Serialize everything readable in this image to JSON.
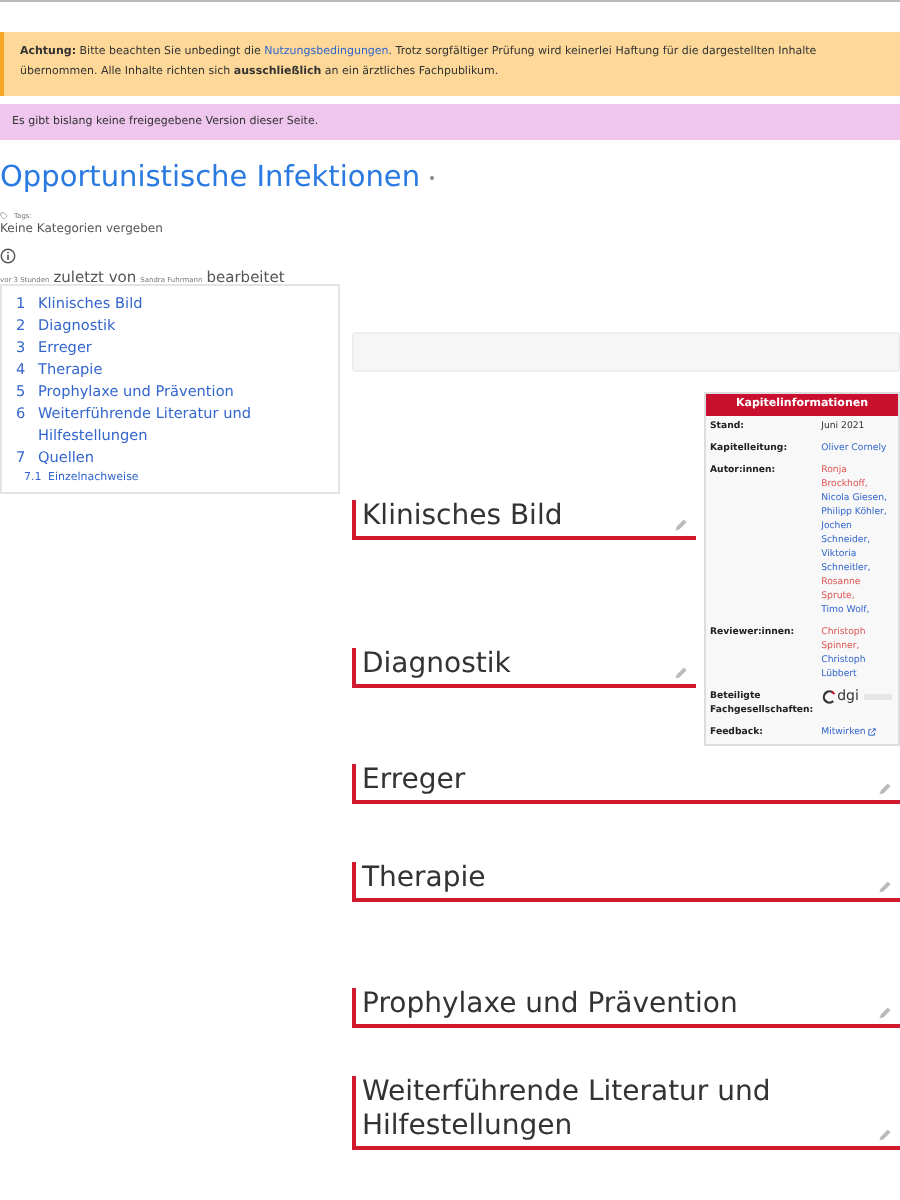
{
  "notice": {
    "label": "Achtung:",
    "before": "Bitte beachten Sie unbedingt die",
    "link": "Nutzungsbedingungen",
    "after": ". Trotz sorgfältiger Prüfung wird keinerlei Haftung für die dargestellten Inhalte übernommen. Alle Inhalte richten sich **ausschließlich** an ein ärztliches Fachpublikum."
  },
  "revision_notice": "Es gibt bislang keine freigegebene Version dieser Seite.",
  "page_title": "Opportunistische Infektionen",
  "tags_label": "Tags:",
  "categories": "Keine Kategorien vergeben",
  "edit_info": [
    {
      "text": "vor 3 Stunden",
      "kind": "small"
    },
    {
      "text": "zuletzt von",
      "kind": "large"
    },
    {
      "text": "Sandra Fuhrmann",
      "kind": "small"
    },
    {
      "text": "bearbeitet",
      "kind": "large"
    }
  ],
  "toc": [
    {
      "number": "1",
      "label": "Klinisches Bild"
    },
    {
      "number": "2",
      "label": "Diagnostik"
    },
    {
      "number": "3",
      "label": "Erreger"
    },
    {
      "number": "4",
      "label": "Therapie"
    },
    {
      "number": "5",
      "label": "Prophylaxe und Prävention"
    },
    {
      "number": "6",
      "label": "Weiterführende Literatur und Hilfestellungen"
    },
    {
      "number": "7",
      "label": "Quellen",
      "children": [
        {
          "number": "7.1",
          "label": "Einzelnachweise"
        }
      ]
    }
  ],
  "infobox": {
    "title": "Kapitelinformationen",
    "rows": [
      {
        "label": "Stand:",
        "kind": "text",
        "value": "Juni 2021"
      },
      {
        "label": "Kapitelleitung:",
        "kind": "links",
        "links": [
          {
            "text": "Oliver Cornely",
            "exists": true
          }
        ]
      },
      {
        "label": "Autor:innen:",
        "kind": "links",
        "links": [
          {
            "text": "Ronja Brockhoff,",
            "exists": false
          },
          {
            "text": "Nicola Giesen,",
            "exists": true
          },
          {
            "text": "Philipp Köhler,",
            "exists": true
          },
          {
            "text": "Jochen Schneider,",
            "exists": true
          },
          {
            "text": "Viktoria Schneitler,",
            "exists": true
          },
          {
            "text": "Rosanne Sprute,",
            "exists": false
          },
          {
            "text": "Timo Wolf,",
            "exists": true
          }
        ]
      },
      {
        "label": "Reviewer:innen:",
        "kind": "links",
        "links": [
          {
            "text": "Christoph Spinner,",
            "exists": false
          },
          {
            "text": "Christoph Lübbert",
            "exists": true
          }
        ]
      },
      {
        "label": "Beteiligte Fachgesellschaften:",
        "kind": "logo",
        "value": "dgi"
      },
      {
        "label": "Feedback:",
        "kind": "external",
        "value": "Mitwirken"
      }
    ]
  },
  "sections": [
    {
      "title": "Klinisches Bild"
    },
    {
      "title": "Diagnostik"
    },
    {
      "title": "Erreger"
    },
    {
      "title": "Therapie"
    },
    {
      "title": "Prophylaxe und Prävention"
    },
    {
      "title": "Weiterführende Literatur und Hilfestellungen"
    }
  ]
}
